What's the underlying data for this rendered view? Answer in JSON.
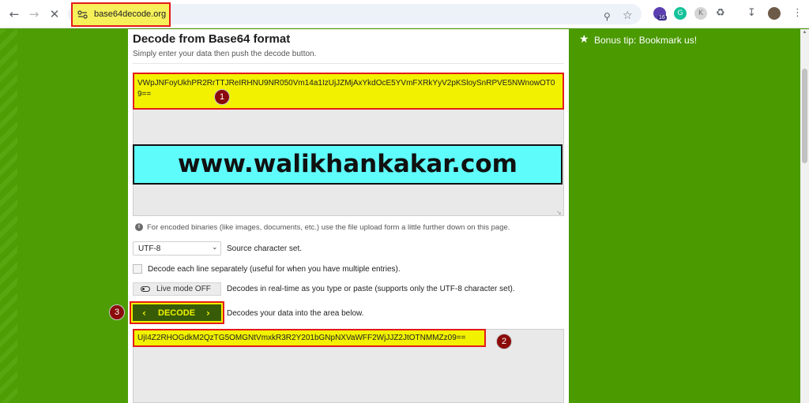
{
  "browser": {
    "url": "base64decode.org",
    "extension_badge": "16"
  },
  "page": {
    "title": "Decode from Base64 format",
    "subtitle": "Simply enter your data then push the decode button.",
    "input_value": "VWpJNFoyUkhPR2RrTTJReIRHNU9NR050Vm14a1IzUjJZMjAxYkdOcE5YVmFXRkYyV2pKSloySnRPVE5NWnowOT09==",
    "watermark": "www.walikhankakar.com",
    "info_text": "For encoded binaries (like images, documents, etc.) use the file upload form a little further down on this page.",
    "charset_select": "UTF-8",
    "charset_label": "Source character set.",
    "each_line_label": "Decode each line separately (useful for when you have multiple entries).",
    "live_mode_label": "Live mode OFF",
    "live_mode_desc": "Decodes in real-time as you type or paste (supports only the UTF-8 character set).",
    "decode_button": "DECODE",
    "decode_desc": "Decodes your data into the area below.",
    "output_value": "UjI4Z2RHOGdkM2QzTG5OMGNtVmxkR3R2Y201bGNpNXVaWFF2WjJJZ2JtOTNMMZz09=="
  },
  "markers": [
    "1",
    "2",
    "3"
  ],
  "sidebar": {
    "bonus_tip": "Bonus tip: Bookmark us!"
  },
  "colors": {
    "page_green": "#4a9a00",
    "highlight_yellow": "#f2f200",
    "highlight_red": "#e41b1b",
    "decode_button_bg": "#375b07",
    "watermark_cyan": "#5ffcfc",
    "marker_red": "#8b0a0a"
  }
}
